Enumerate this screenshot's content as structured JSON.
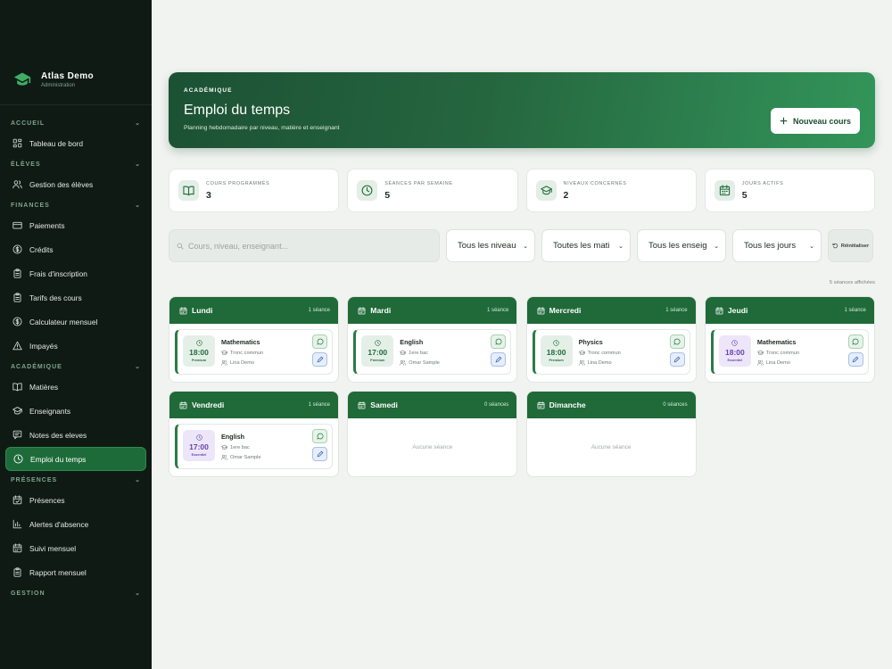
{
  "brand": {
    "title": "Atlas Demo",
    "subtitle": "Administration"
  },
  "sidebar": {
    "sections": [
      {
        "label": "ACCUEIL",
        "items": [
          {
            "label": "Tableau de bord",
            "icon": "dashboard-icon"
          }
        ]
      },
      {
        "label": "ÉLÈVES",
        "items": [
          {
            "label": "Gestion des élèves",
            "icon": "users-icon"
          }
        ]
      },
      {
        "label": "FINANCES",
        "items": [
          {
            "label": "Paiements",
            "icon": "credit-card-icon"
          },
          {
            "label": "Crédits",
            "icon": "dollar-icon"
          },
          {
            "label": "Frais d'inscription",
            "icon": "clipboard-icon"
          },
          {
            "label": "Tarifs des cours",
            "icon": "clipboard-icon"
          },
          {
            "label": "Calculateur mensuel",
            "icon": "dollar-icon"
          },
          {
            "label": "Impayés",
            "icon": "warning-icon"
          }
        ]
      },
      {
        "label": "ACADÉMIQUE",
        "items": [
          {
            "label": "Matières",
            "icon": "book-icon"
          },
          {
            "label": "Enseignants",
            "icon": "graduation-cap-icon"
          },
          {
            "label": "Notes des eleves",
            "icon": "chat-icon"
          },
          {
            "label": "Emploi du temps",
            "icon": "clock-icon",
            "active": true
          }
        ]
      },
      {
        "label": "PRÉSENCES",
        "items": [
          {
            "label": "Présences",
            "icon": "calendar-check-icon"
          },
          {
            "label": "Alertes d'absence",
            "icon": "bar-chart-icon"
          },
          {
            "label": "Suivi mensuel",
            "icon": "calendar-icon"
          },
          {
            "label": "Rapport mensuel",
            "icon": "clipboard-icon"
          }
        ]
      },
      {
        "label": "GESTION",
        "items": []
      }
    ]
  },
  "hero": {
    "kicker": "ACADÉMIQUE",
    "title": "Emploi du temps",
    "subtitle": "Planning hebdomadaire par niveau, matière et enseignant",
    "button_label": "Nouveau cours"
  },
  "stats": [
    {
      "label": "COURS PROGRAMMÉS",
      "value": "3",
      "icon": "book-icon"
    },
    {
      "label": "SÉANCES PAR SEMAINE",
      "value": "5",
      "icon": "clock-icon"
    },
    {
      "label": "NIVEAUX CONCERNÉS",
      "value": "2",
      "icon": "graduation-cap-icon"
    },
    {
      "label": "JOURS ACTIFS",
      "value": "5",
      "icon": "calendar-icon"
    }
  ],
  "filters": {
    "search_placeholder": "Cours, niveau, enseignant...",
    "selects": [
      "Tous les niveau",
      "Toutes les mati",
      "Tous les enseig",
      "Tous les jours"
    ],
    "reset_label": "Réinitialiser"
  },
  "sessions_count": "5 séances affichées",
  "empty_label": "Aucune séance",
  "days": [
    {
      "name": "Lundi",
      "count": "1 séance",
      "courses": [
        {
          "title": "Mathematics",
          "time": "18:00",
          "tag": "Premium",
          "level": "Tronc commun",
          "teacher": "Lina Demo",
          "tone": "green"
        }
      ]
    },
    {
      "name": "Mardi",
      "count": "1 séance",
      "courses": [
        {
          "title": "English",
          "time": "17:00",
          "tag": "Premium",
          "level": "1ere bac",
          "teacher": "Omar Sample",
          "tone": "green"
        }
      ]
    },
    {
      "name": "Mercredi",
      "count": "1 séance",
      "courses": [
        {
          "title": "Physics",
          "time": "18:00",
          "tag": "Premium",
          "level": "Tronc commun",
          "teacher": "Lina Demo",
          "tone": "green"
        }
      ]
    },
    {
      "name": "Jeudi",
      "count": "1 séance",
      "courses": [
        {
          "title": "Mathematics",
          "time": "18:00",
          "tag": "Essentiel",
          "level": "Tronc commun",
          "teacher": "Lina Demo",
          "tone": "purple"
        }
      ]
    },
    {
      "name": "Vendredi",
      "count": "1 séance",
      "courses": [
        {
          "title": "English",
          "time": "17:00",
          "tag": "Essentiel",
          "level": "1ere bac",
          "teacher": "Omar Sample",
          "tone": "purple"
        }
      ]
    },
    {
      "name": "Samedi",
      "count": "0 séances",
      "courses": []
    },
    {
      "name": "Dimanche",
      "count": "0 séances",
      "courses": []
    }
  ],
  "colors": {
    "sidebar_bg": "#0f1a14",
    "accent": "#1f6a38",
    "active_item": "#1e6b3a",
    "premium": "#1f6a38",
    "essentiel": "#6a3fb0"
  }
}
